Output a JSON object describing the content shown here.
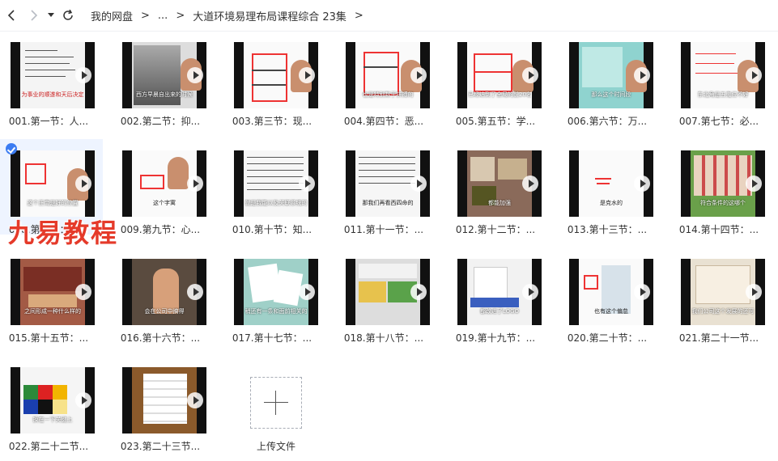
{
  "nav": {
    "back_icon": "chevron-left-icon",
    "forward_icon": "chevron-right-icon",
    "dropdown_icon": "caret-down-icon",
    "refresh_icon": "refresh-icon"
  },
  "breadcrumb": {
    "root": "我的网盘",
    "ellipsis": "...",
    "current": "大道环境易理布局课程综合 23集"
  },
  "files": [
    {
      "name": "001.第一节：人...",
      "caption": "为事业的顺遂和天后决定"
    },
    {
      "name": "002.第二节：抑...",
      "caption": "西方早晨自出来的时候"
    },
    {
      "name": "003.第三节：现...",
      "caption": ""
    },
    {
      "name": "004.第四节：恶...",
      "caption": "也是特别数于拼搏的"
    },
    {
      "name": "005.第五节：学...",
      "caption": "已经达到了全局的前20名"
    },
    {
      "name": "006.第六节：万...",
      "caption": "那么这个时间段"
    },
    {
      "name": "007.第七节：必...",
      "caption": "东北角是五鬼位不好"
    },
    {
      "name": "008.第八节：如...",
      "caption": "这个正南是好的位置"
    },
    {
      "name": "009.第九节：心...",
      "caption": "这个字寓"
    },
    {
      "name": "010.第十节：知...",
      "caption": "就是我能以及关联系统的"
    },
    {
      "name": "011.第十一节：...",
      "caption": "那我们再看西四命的"
    },
    {
      "name": "012.第十二节：...",
      "caption": "都能加强"
    },
    {
      "name": "013.第十三节：...",
      "caption": "是克水的"
    },
    {
      "name": "014.第十四节：...",
      "caption": "符合条件的这哪个"
    },
    {
      "name": "015.第十五节：...",
      "caption": "之间形成一种什么样的"
    },
    {
      "name": "016.第十六节：...",
      "caption": "会在公司中搞得"
    },
    {
      "name": "017.第十七节：...",
      "caption": "稍还有一条和面前相关的"
    },
    {
      "name": "018.第十八节：...",
      "caption": ""
    },
    {
      "name": "019.第十九节：...",
      "caption": "都改进了LOGO"
    },
    {
      "name": "020.第二十节：...",
      "caption": "也有这个偏怠"
    },
    {
      "name": "021.第二十一节...",
      "caption": "我们公司这个发展的还可"
    },
    {
      "name": "022.第二十二节...",
      "caption": "换在一下关键上"
    },
    {
      "name": "023.第二十三节...",
      "caption": ""
    }
  ],
  "upload": {
    "label": "上传文件",
    "icon": "plus-icon"
  },
  "watermark": "九易教程",
  "colors": {
    "accent": "#3b7cf2",
    "selected_bg": "#eef4ff",
    "watermark": "#e53a2a"
  }
}
